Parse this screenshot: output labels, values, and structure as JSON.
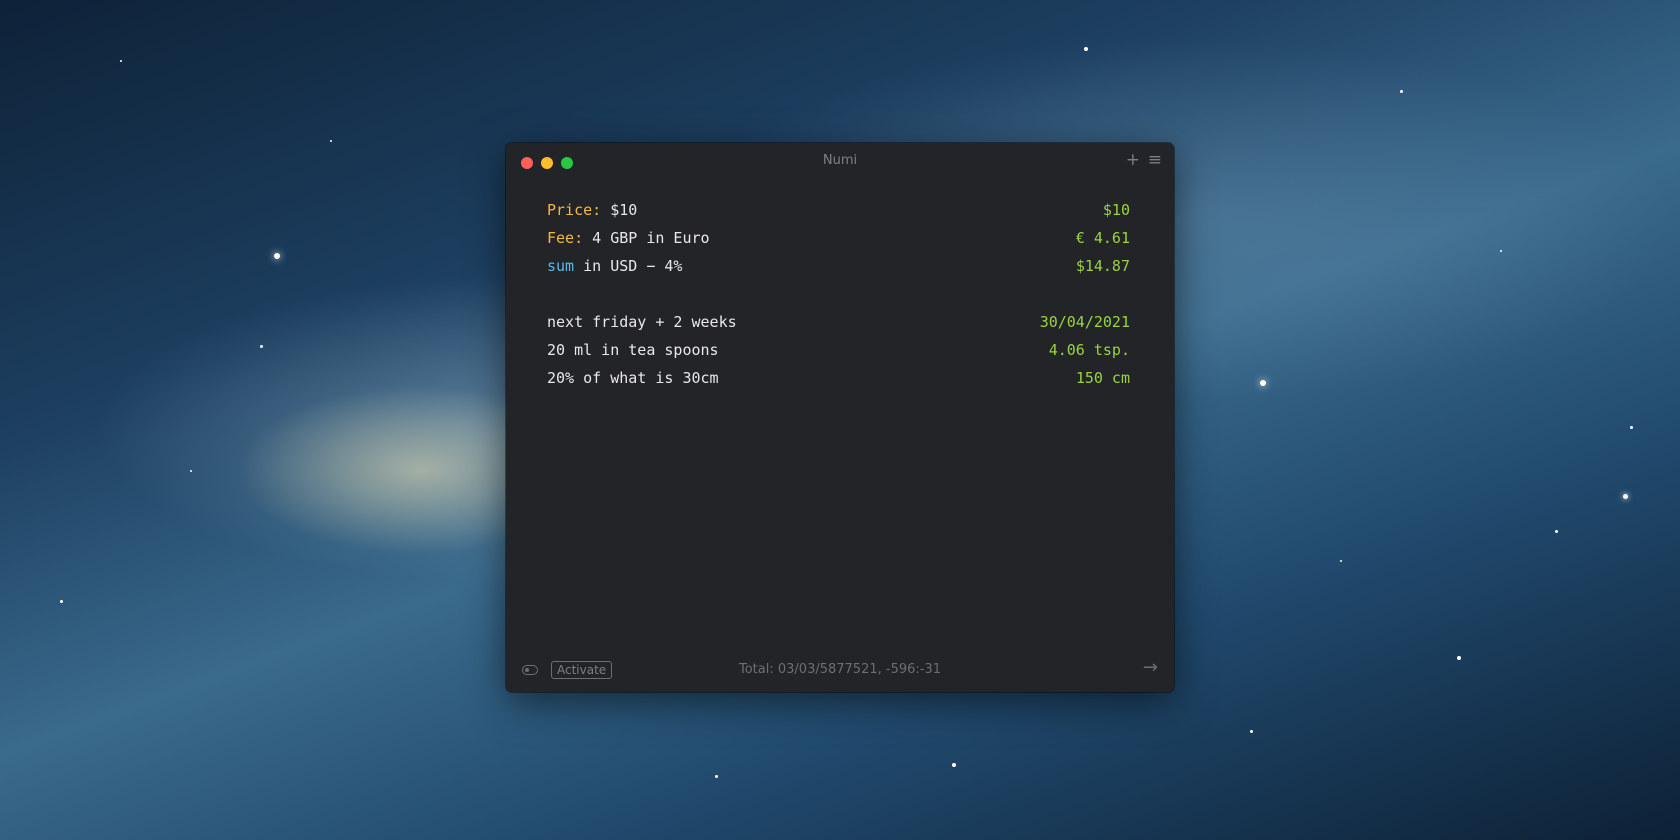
{
  "window": {
    "title": "Numi"
  },
  "toolbar": {
    "add_glyph": "+",
    "menu_glyph": "≡"
  },
  "sheet": {
    "lines": [
      {
        "label": "Price:",
        "expr": " $10",
        "result": "$10"
      },
      {
        "label": "Fee:",
        "expr": " 4 GBP in Euro",
        "result": "€ 4.61"
      },
      {
        "variable": "sum",
        "expr": " in USD − 4%",
        "result": "$14.87"
      },
      {
        "expr": "next friday + 2 weeks",
        "result": "30/04/2021"
      },
      {
        "expr": "20 ml in tea spoons",
        "result": "4.06 tsp."
      },
      {
        "expr": "20% of what is 30cm",
        "result": "150 cm"
      }
    ]
  },
  "status": {
    "activate_label": "Activate",
    "total_text": "Total: 03/03/5877521, -596:-31",
    "arrow_glyph": "→"
  },
  "colors": {
    "label": "#f5b942",
    "variable": "#5fb8e8",
    "result": "#9ad43f",
    "window_bg": "#232428",
    "close": "#fe5f57",
    "minimize": "#febc2e",
    "maximize": "#28c840"
  },
  "icons": [
    "toggle-icon",
    "add-icon",
    "menu-icon",
    "arrow-right-icon"
  ]
}
